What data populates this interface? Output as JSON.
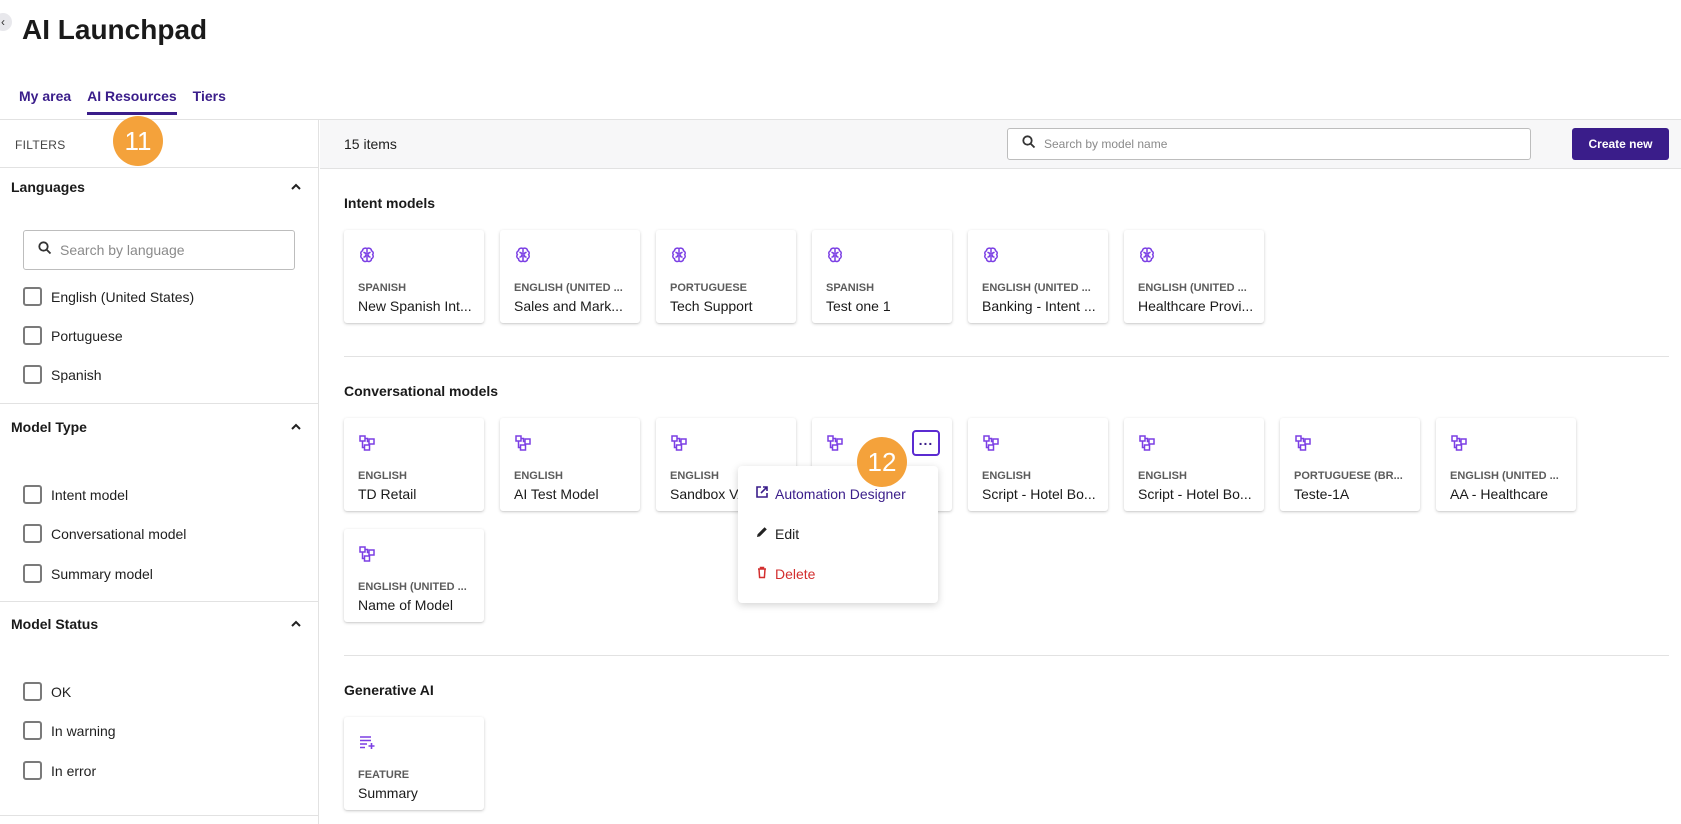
{
  "page": {
    "title": "AI Launchpad"
  },
  "tabs": [
    {
      "label": "My area",
      "active": false
    },
    {
      "label": "AI Resources",
      "active": true
    },
    {
      "label": "Tiers",
      "active": false
    }
  ],
  "filters": {
    "label": "FILTERS",
    "languages": {
      "title": "Languages",
      "search_placeholder": "Search by language",
      "options": [
        "English (United States)",
        "Portuguese",
        "Spanish"
      ]
    },
    "model_type": {
      "title": "Model Type",
      "options": [
        "Intent model",
        "Conversational model",
        "Summary model"
      ]
    },
    "model_status": {
      "title": "Model Status",
      "options": [
        "OK",
        "In warning",
        "In error"
      ]
    }
  },
  "toolbar": {
    "items_count": "15 items",
    "search_placeholder": "Search by model name",
    "create_label": "Create new"
  },
  "groups": {
    "intent": {
      "title": "Intent models",
      "cards": [
        {
          "lang": "SPANISH",
          "name": "New Spanish Int..."
        },
        {
          "lang": "ENGLISH (UNITED ...",
          "name": "Sales and Mark..."
        },
        {
          "lang": "PORTUGUESE",
          "name": "Tech Support"
        },
        {
          "lang": "SPANISH",
          "name": "Test one 1"
        },
        {
          "lang": "ENGLISH (UNITED ...",
          "name": "Banking - Intent ..."
        },
        {
          "lang": "ENGLISH (UNITED ...",
          "name": "Healthcare Provi..."
        }
      ]
    },
    "conversational": {
      "title": "Conversational models",
      "cards": [
        {
          "lang": "ENGLISH",
          "name": "TD Retail"
        },
        {
          "lang": "ENGLISH",
          "name": "AI Test Model"
        },
        {
          "lang": "ENGLISH",
          "name": "Sandbox VA"
        },
        {
          "lang": "",
          "name": ""
        },
        {
          "lang": "ENGLISH",
          "name": "Script - Hotel Bo..."
        },
        {
          "lang": "ENGLISH",
          "name": "Script - Hotel Bo..."
        },
        {
          "lang": "PORTUGUESE (BR...",
          "name": "Teste-1A"
        },
        {
          "lang": "ENGLISH (UNITED ...",
          "name": "AA - Healthcare"
        },
        {
          "lang": "ENGLISH (UNITED ...",
          "name": "Name of Model"
        }
      ]
    },
    "generative": {
      "title": "Generative AI",
      "cards": [
        {
          "lang": "FEATURE",
          "name": "Summary"
        }
      ]
    }
  },
  "context_menu": {
    "items": [
      {
        "label": "Automation Designer",
        "icon": "external-link-icon"
      },
      {
        "label": "Edit",
        "icon": "pencil-icon"
      },
      {
        "label": "Delete",
        "icon": "trash-icon"
      }
    ]
  },
  "badges": [
    "11",
    "12"
  ],
  "colors": {
    "primary": "#3a1d8a",
    "icon_purple": "#7b3fe4",
    "danger": "#d32f2f",
    "badge": "#f4a23b"
  }
}
